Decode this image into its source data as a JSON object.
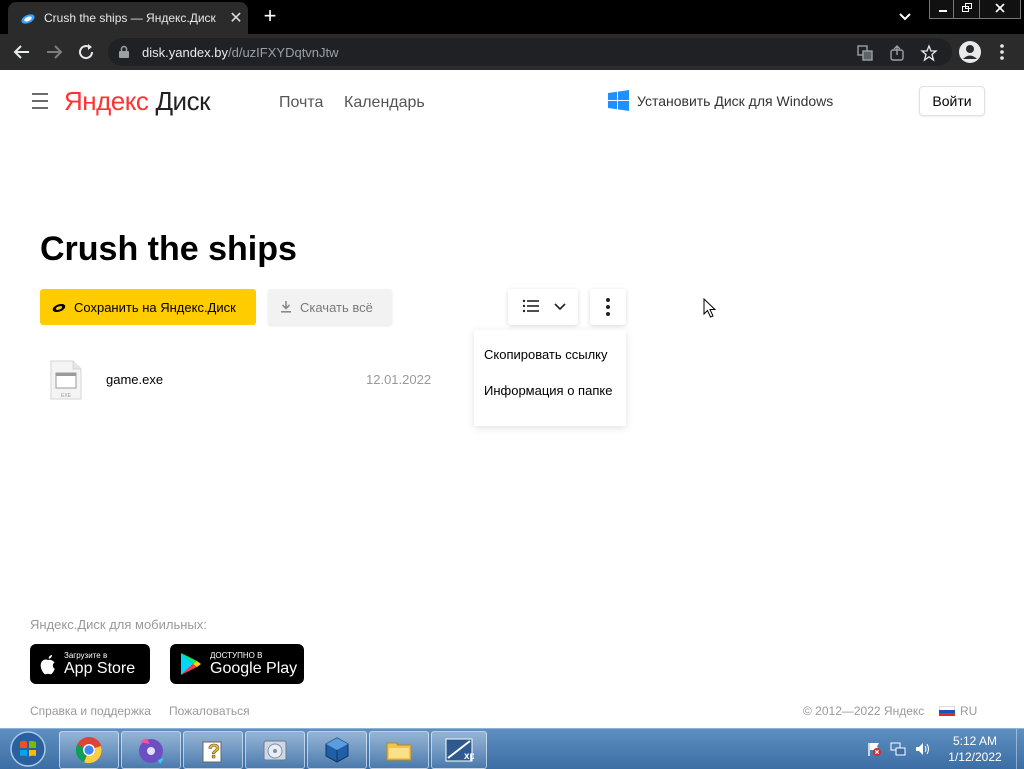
{
  "browser": {
    "tab_title": "Crush the ships — Яндекс.Диск",
    "url_host": "disk.yandex.by",
    "url_path": "/d/uzIFXYDqtvnJtw"
  },
  "header": {
    "logo_ya": "Яндекс",
    "logo_disk": "Диск",
    "nav": [
      "Почта",
      "Календарь"
    ],
    "install_label": "Установить Диск для Windows",
    "login_label": "Войти"
  },
  "folder": {
    "title": "Crush the ships",
    "save_label": "Сохранить на Яндекс.Диск",
    "download_label": "Скачать всё"
  },
  "context_menu": {
    "items": [
      "Скопировать ссылку",
      "Информация о папке"
    ]
  },
  "files": [
    {
      "name": "game.exe",
      "date": "12.01.2022",
      "ext": "EXE"
    }
  ],
  "footer": {
    "mobile_label": "Яндекс.Диск для мобильных:",
    "appstore_small": "Загрузите в",
    "appstore_big": "App Store",
    "gplay_small": "ДОСТУПНО В",
    "gplay_big": "Google Play",
    "help_label": "Справка и поддержка",
    "complain_label": "Пожаловаться",
    "copyright": "© 2012—2022 Яндекс",
    "lang": "RU"
  },
  "taskbar": {
    "time": "5:12 AM",
    "date": "1/12/2022"
  },
  "colors": {
    "accent_yellow": "#ffcc00",
    "yandex_red": "#ff3333",
    "taskbar_blue": "#3b6ea5"
  }
}
